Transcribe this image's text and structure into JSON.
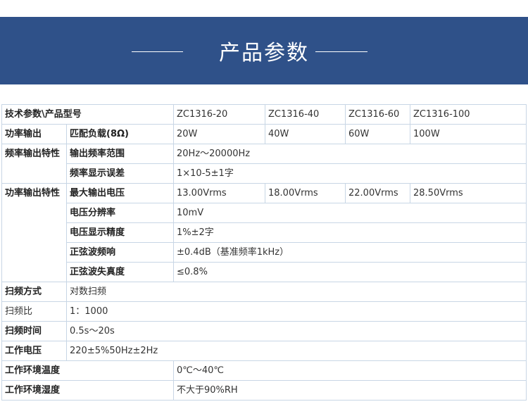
{
  "banner": {
    "title": "产品参数"
  },
  "table": {
    "header": {
      "label": "技术参数\\产品型号",
      "models": [
        "ZC1316-20",
        "ZC1316-40",
        "ZC1316-60",
        "ZC1316-100"
      ]
    },
    "power_output": {
      "group": "功率输出",
      "param": "匹配负载(8Ω)",
      "values": [
        "20W",
        "40W",
        "60W",
        "100W"
      ]
    },
    "freq_output": {
      "group": "频率输出特性",
      "rows": [
        {
          "param": "输出频率范围",
          "value": "20Hz～20000Hz"
        },
        {
          "param": "频率显示误差",
          "value": "1×10-5±1字"
        }
      ]
    },
    "power_output_char": {
      "group": "功率输出特性",
      "max_voltage": {
        "param": "最大输出电压",
        "values": [
          "13.00Vrms",
          "18.00Vrms",
          "22.00Vrms",
          "28.50Vrms"
        ]
      },
      "rows": [
        {
          "param": "电压分辨率",
          "value": "10mV"
        },
        {
          "param": "电压显示精度",
          "value": "1%±2字"
        },
        {
          "param": "正弦波频响",
          "value": "±0.4dB（基准频率1kHz）"
        },
        {
          "param": "正弦波失真度",
          "value": "≤0.8%"
        }
      ]
    },
    "simple_rows": [
      {
        "label": "扫频方式",
        "value": "对数扫频"
      },
      {
        "label": "扫频比",
        "value": "1：1000"
      },
      {
        "label": "扫频时间",
        "value": "0.5s～20s"
      },
      {
        "label": "工作电压",
        "value": "220±5%50Hz±2Hz"
      }
    ],
    "env_rows": [
      {
        "label": "工作环境温度",
        "value": "0℃～40℃"
      },
      {
        "label": "工作环境湿度",
        "value": "不大于90%RH"
      }
    ]
  }
}
